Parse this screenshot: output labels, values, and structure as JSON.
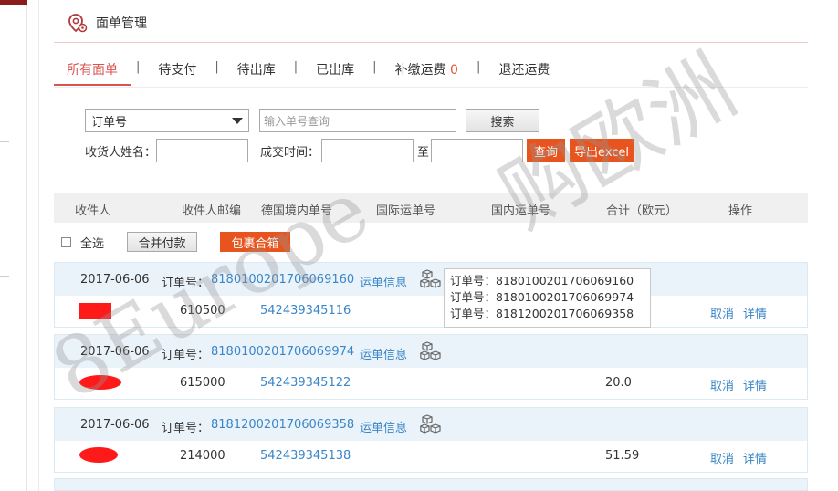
{
  "header": {
    "title": "面单管理"
  },
  "tabs": [
    {
      "label": "所有面单",
      "count": ""
    },
    {
      "label": "待支付",
      "count": ""
    },
    {
      "label": "待出库",
      "count": ""
    },
    {
      "label": "已出库",
      "count": ""
    },
    {
      "label": "补缴运费",
      "count": "0"
    },
    {
      "label": "退还运费",
      "count": ""
    }
  ],
  "tab_separator": "|",
  "search": {
    "type_selected": "订单号",
    "number_placeholder": "输入单号查询",
    "search_button": "搜索",
    "name_label": "收货人姓名：",
    "time_label": "成交时间：",
    "to_label": "至",
    "query_button": "查询",
    "export_button": "导出excel"
  },
  "table": {
    "headers": [
      "收件人",
      "收件人邮编",
      "德国境内单号",
      "国际运单号",
      "国内运单号",
      "合计（欧元）",
      "操作"
    ]
  },
  "batch": {
    "select_all": "全选",
    "merge_pay": "合并付款",
    "pack_merge": "包裹合箱"
  },
  "orders": [
    {
      "date": "2017-06-06",
      "order_label": "订单号：",
      "order_no": "8180100201706069160",
      "waybill_info": "运单信息",
      "postcode": "610500",
      "de_tracking": "542439345116",
      "total": "",
      "cancel": "取消",
      "detail": "详情"
    },
    {
      "date": "2017-06-06",
      "order_label": "订单号：",
      "order_no": "8180100201706069974",
      "waybill_info": "运单信息",
      "postcode": "615000",
      "de_tracking": "542439345122",
      "total": "20.0",
      "cancel": "取消",
      "detail": "详情"
    },
    {
      "date": "2017-06-06",
      "order_label": "订单号：",
      "order_no": "8181200201706069358",
      "waybill_info": "运单信息",
      "postcode": "214000",
      "de_tracking": "542439345138",
      "total": "51.59",
      "cancel": "取消",
      "detail": "详情"
    }
  ],
  "tooltip": {
    "lines": [
      "订单号：8180100201706069160",
      "订单号：8180100201706069974",
      "订单号：8181200201706069358"
    ]
  },
  "watermark": {
    "text1": "8Europe",
    "text2": "购欧洲"
  },
  "colors": {
    "accent_red": "#d9534f",
    "orange": "#e8541e",
    "link_blue": "#3a86c8",
    "row_blue": "#eaf3fa"
  }
}
